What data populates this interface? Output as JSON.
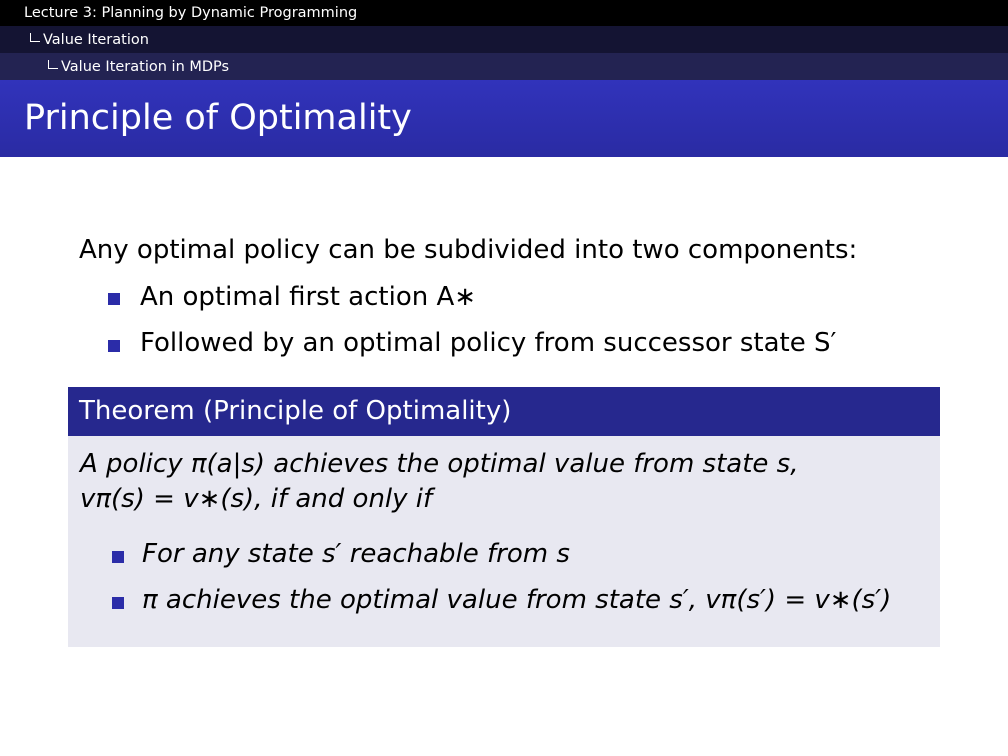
{
  "header": {
    "lecture": "Lecture 3: Planning by Dynamic Programming",
    "section": "Value Iteration",
    "subsection": "Value Iteration in MDPs"
  },
  "slide": {
    "title": "Principle of Optimality",
    "intro": "Any optimal policy can be subdivided into two components:",
    "bullets": [
      "An optimal first action A∗",
      "Followed by an optimal policy from successor state S′"
    ]
  },
  "theorem": {
    "heading": "Theorem (Principle of Optimality)",
    "line1": "A policy π(a|s) achieves the optimal value from state s,",
    "line2": "vπ(s) = v∗(s), if and only if",
    "bullets": [
      "For any state s′ reachable from s",
      "π achieves the optimal value from state s′, vπ(s′) = v∗(s′)"
    ]
  },
  "colors": {
    "header_black": "#000000",
    "title_bar": "#2e30b0",
    "theorem_head": "#26288e",
    "theorem_body": "#e8e8f1",
    "bullet": "#2b2ca8"
  },
  "icons": {
    "bullet": "square-bullet-icon",
    "hierarchy": "corner-connector-icon"
  }
}
